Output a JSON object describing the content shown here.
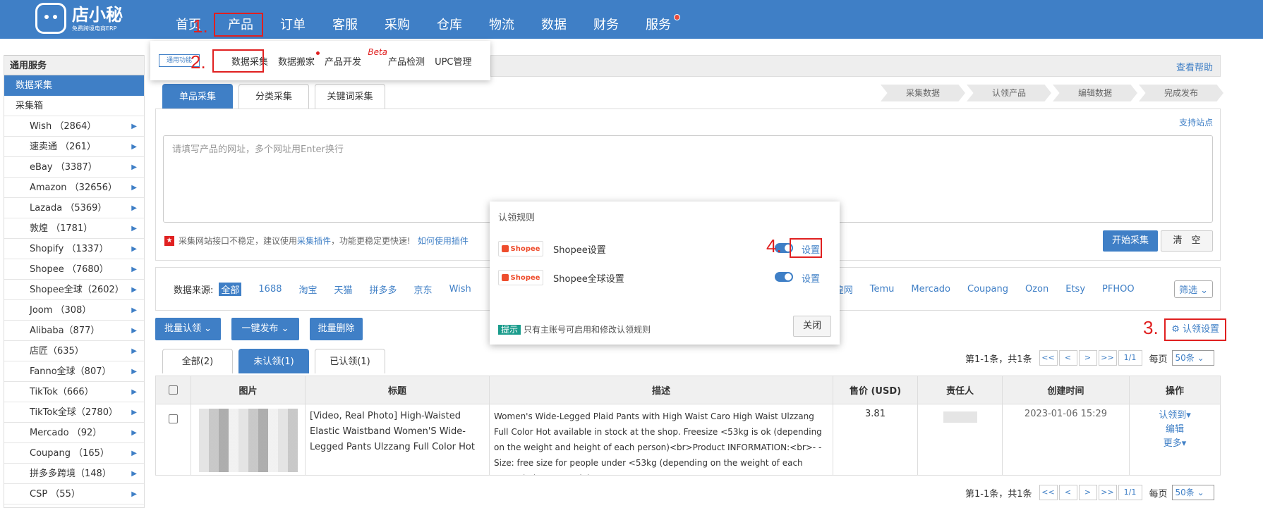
{
  "logo": {
    "name": "店小秘",
    "sub": "免费跨境电商ERP"
  },
  "nav": [
    "首页",
    "产品",
    "订单",
    "客服",
    "采购",
    "仓库",
    "物流",
    "数据",
    "财务",
    "服务"
  ],
  "annotations": {
    "n1": "1.",
    "n2": "2.",
    "n3": "3.",
    "n4": "4."
  },
  "submenu": {
    "icon_label": "通用功能",
    "items": [
      "数据采集",
      "数据搬家",
      "产品开发",
      "产品检测",
      "UPC管理"
    ],
    "beta": "Beta"
  },
  "help": "查看帮助",
  "sidebar": {
    "section": "通用服务",
    "active": "数据采集",
    "sub": "采集箱",
    "items": [
      "Wish （2864）",
      "速卖通 （261）",
      "eBay （3387）",
      "Amazon （32656）",
      "Lazada （5369）",
      "敦煌 （1781）",
      "Shopify （1337）",
      "Shopee （7680）",
      "Shopee全球（2602）",
      "Joom （308）",
      "Alibaba（877）",
      "店匠（635）",
      "Fanno全球（807）",
      "TikTok（666）",
      "TikTok全球（2780）",
      "Mercado （92）",
      "Coupang （165）",
      "拼多多跨境（148）",
      "CSP （55）"
    ]
  },
  "collect_tabs": [
    "单品采集",
    "分类采集",
    "关键词采集"
  ],
  "steps": [
    "采集数据",
    "认领产品",
    "编辑数据",
    "完成发布"
  ],
  "collect": {
    "support": "支持站点",
    "placeholder": "请填写产品的网址，多个网址用Enter换行",
    "warn_text": "采集网站接口不稳定，建议使用",
    "warn_link": "采集插件",
    "warn_text2": "，功能更稳定更快速!",
    "warn_link2": "如何使用插件",
    "start": "开始采集",
    "clear": "清　空"
  },
  "sources": {
    "label": "数据来源:",
    "items": [
      "全部",
      "1688",
      "淘宝",
      "天猫",
      "拼多多",
      "京东",
      "Wish"
    ],
    "items_right": [
      "敦煌网",
      "Temu",
      "Mercado",
      "Coupang",
      "Ozon",
      "Etsy",
      "PFHOO"
    ],
    "filter": "筛选"
  },
  "actions": {
    "batch_claim": "批量认领",
    "one_publish": "一键发布",
    "batch_delete": "批量删除",
    "claim_settings": "认领设置"
  },
  "claim_tabs": [
    "全部(2)",
    "未认领(1)",
    "已认领(1)"
  ],
  "pager": {
    "info": "第1-1条，共1条",
    "buttons": [
      "<<",
      "<",
      ">",
      ">>"
    ],
    "page": "1/1",
    "per_label": "每页",
    "per": "50条"
  },
  "table": {
    "headers": [
      "图片",
      "标题",
      "描述",
      "售价 (USD)",
      "责任人",
      "创建时间",
      "操作"
    ],
    "rows": [
      {
        "title": "[Video, Real Photo] High-Waisted Elastic Waistband Women'S Wide-Legged Pants Ulzzang Full Color Hot",
        "desc": "Women's Wide-Legged Plaid Pants with High Waist Caro High Waist Ulzzang Full Color Hot available in stock at the shop. Freesize <53kg is ok (depending on the weight and height of each person)<br>Product INFORMATION:<br>- - Size: free size for people under <53kg (depending on the weight of each person)<br>- Material:",
        "price": "3.81",
        "created": "2023-01-06 15:29",
        "ops": [
          "认领到▾",
          "编辑",
          "更多▾"
        ]
      }
    ]
  },
  "modal": {
    "title": "认领规则",
    "rows": [
      {
        "logo": "Shopee",
        "label": "Shopee设置",
        "action": "设置"
      },
      {
        "logo": "Shopee",
        "label": "Shopee全球设置",
        "action": "设置"
      }
    ],
    "tip": "提示",
    "tip_text": "只有主账号可启用和修改认领规则",
    "close": "关闭"
  }
}
